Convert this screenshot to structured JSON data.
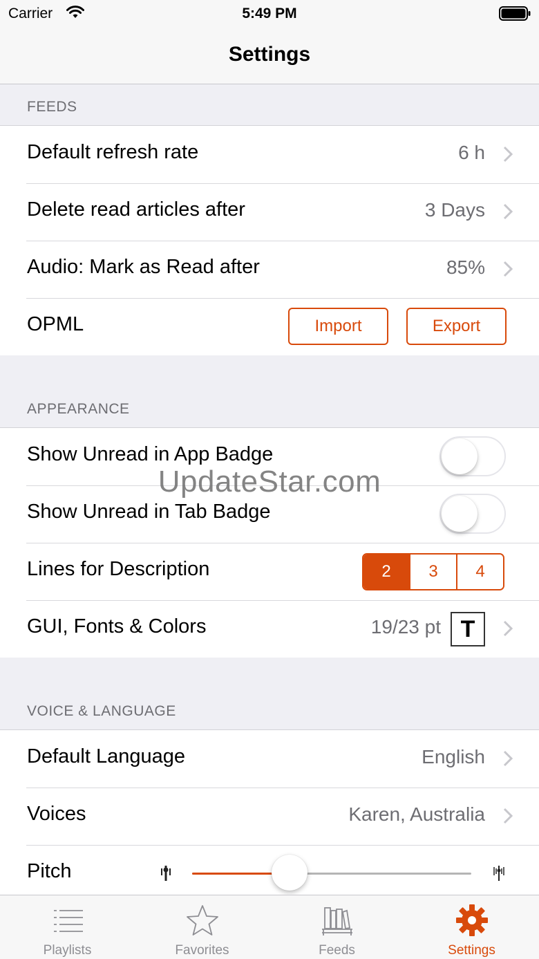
{
  "status_bar": {
    "carrier": "Carrier",
    "time": "5:49 PM"
  },
  "nav": {
    "title": "Settings"
  },
  "feeds": {
    "header": "FEEDS",
    "refresh": {
      "label": "Default refresh rate",
      "value": "6 h"
    },
    "delete": {
      "label": "Delete read articles after",
      "value": "3 Days"
    },
    "audio": {
      "label": "Audio: Mark as Read after",
      "value": "85%"
    },
    "opml": {
      "label": "OPML",
      "import_label": "Import",
      "export_label": "Export"
    }
  },
  "appearance": {
    "header": "APPEARANCE",
    "app_badge": {
      "label": "Show Unread in App Badge",
      "on": false
    },
    "tab_badge": {
      "label": "Show Unread in Tab Badge",
      "on": false
    },
    "lines": {
      "label": "Lines for Description",
      "options": [
        "2",
        "3",
        "4"
      ],
      "selected": "2"
    },
    "gui": {
      "label": "GUI, Fonts & Colors",
      "value": "19/23 pt",
      "font_glyph": "T"
    }
  },
  "voice": {
    "header": "VOICE & LANGUAGE",
    "language": {
      "label": "Default Language",
      "value": "English"
    },
    "voices": {
      "label": "Voices",
      "value": "Karen, Australia"
    },
    "pitch": {
      "label": "Pitch",
      "level": 0.35
    }
  },
  "watermark": "UpdateStar.com",
  "tabs": [
    {
      "label": "Playlists",
      "icon": "list-icon"
    },
    {
      "label": "Favorites",
      "icon": "star-icon"
    },
    {
      "label": "Feeds",
      "icon": "bookshelf-icon"
    },
    {
      "label": "Settings",
      "icon": "gear-icon"
    }
  ],
  "colors": {
    "accent": "#d84a0b",
    "secondary_text": "#6d6d72",
    "background": "#efeff4"
  }
}
